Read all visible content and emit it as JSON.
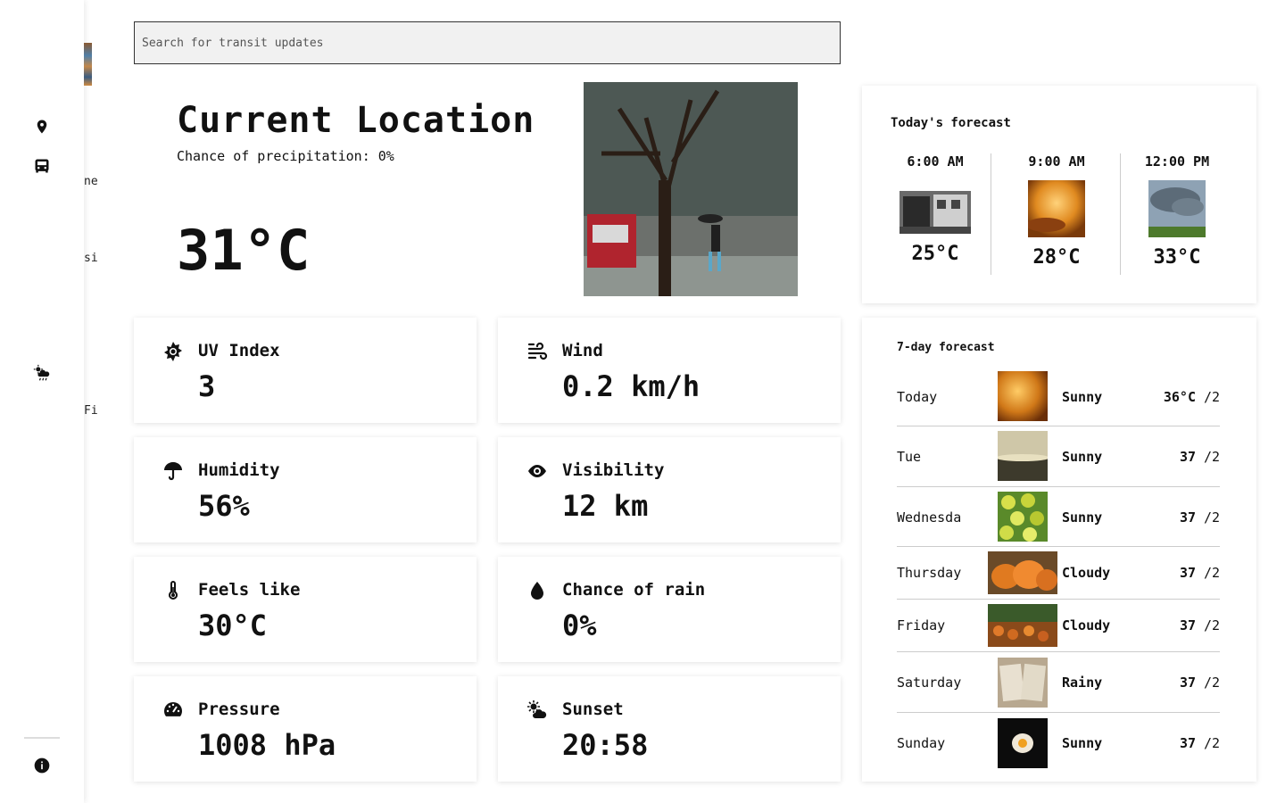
{
  "sidebar": {
    "fragments": [
      "ne",
      "si",
      "Fi"
    ]
  },
  "search": {
    "placeholder": "Search for transit updates"
  },
  "current": {
    "title": "Current Location",
    "precipitation": "Chance of precipitation: 0%",
    "temperature": "31°C"
  },
  "stats": {
    "uv": {
      "label": "UV Index",
      "value": "3"
    },
    "wind": {
      "label": "Wind",
      "value": "0.2 km/h"
    },
    "humidity": {
      "label": "Humidity",
      "value": "56%"
    },
    "visibility": {
      "label": "Visibility",
      "value": "12 km"
    },
    "feels": {
      "label": "Feels like",
      "value": "30°C"
    },
    "rain": {
      "label": "Chance of rain",
      "value": "0%"
    },
    "pressure": {
      "label": "Pressure",
      "value": "1008 hPa"
    },
    "sunset": {
      "label": "Sunset",
      "value": "20:58"
    }
  },
  "today": {
    "title": "Today's forecast",
    "hours": [
      {
        "time": "6:00 AM",
        "temp": "25°C"
      },
      {
        "time": "9:00 AM",
        "temp": "28°C"
      },
      {
        "time": "12:00 PM",
        "temp": "33°C"
      }
    ]
  },
  "week": {
    "title": "7-day forecast",
    "days": [
      {
        "day": "Today",
        "condition": "Sunny",
        "high": "36°C",
        "low": "/2"
      },
      {
        "day": "Tue",
        "condition": "Sunny",
        "high": "37",
        "low": "/2"
      },
      {
        "day": "Wednesda",
        "condition": "Sunny",
        "high": "37",
        "low": "/2"
      },
      {
        "day": "Thursday",
        "condition": "Cloudy",
        "high": "37",
        "low": "/2"
      },
      {
        "day": "Friday",
        "condition": "Cloudy",
        "high": "37",
        "low": "/2"
      },
      {
        "day": "Saturday",
        "condition": "Rainy",
        "high": "37",
        "low": "/2"
      },
      {
        "day": "Sunday",
        "condition": "Sunny",
        "high": "37",
        "low": "/2"
      }
    ]
  }
}
